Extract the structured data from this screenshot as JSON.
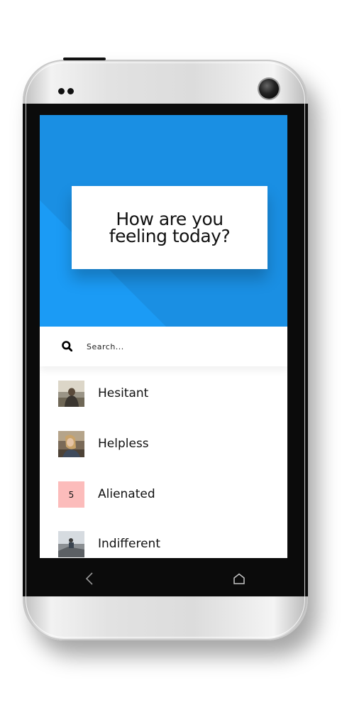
{
  "hero": {
    "title": "How are you\nfeeling today?"
  },
  "search": {
    "placeholder": "Search..."
  },
  "moods": [
    {
      "label": "Hesitant",
      "thumb": "photo-person-seaside"
    },
    {
      "label": "Helpless",
      "thumb": "photo-woman-portrait"
    },
    {
      "label": "Alienated",
      "badge": "5"
    },
    {
      "label": "Indifferent",
      "thumb": "photo-person-sitting"
    }
  ],
  "nav": {
    "back_icon": "chevron-left-icon",
    "home_icon": "home-icon"
  },
  "colors": {
    "hero_blue": "#1b9bf5",
    "hero_blue_dark": "#1a8fe3",
    "badge_pink": "#fcbcbb"
  }
}
